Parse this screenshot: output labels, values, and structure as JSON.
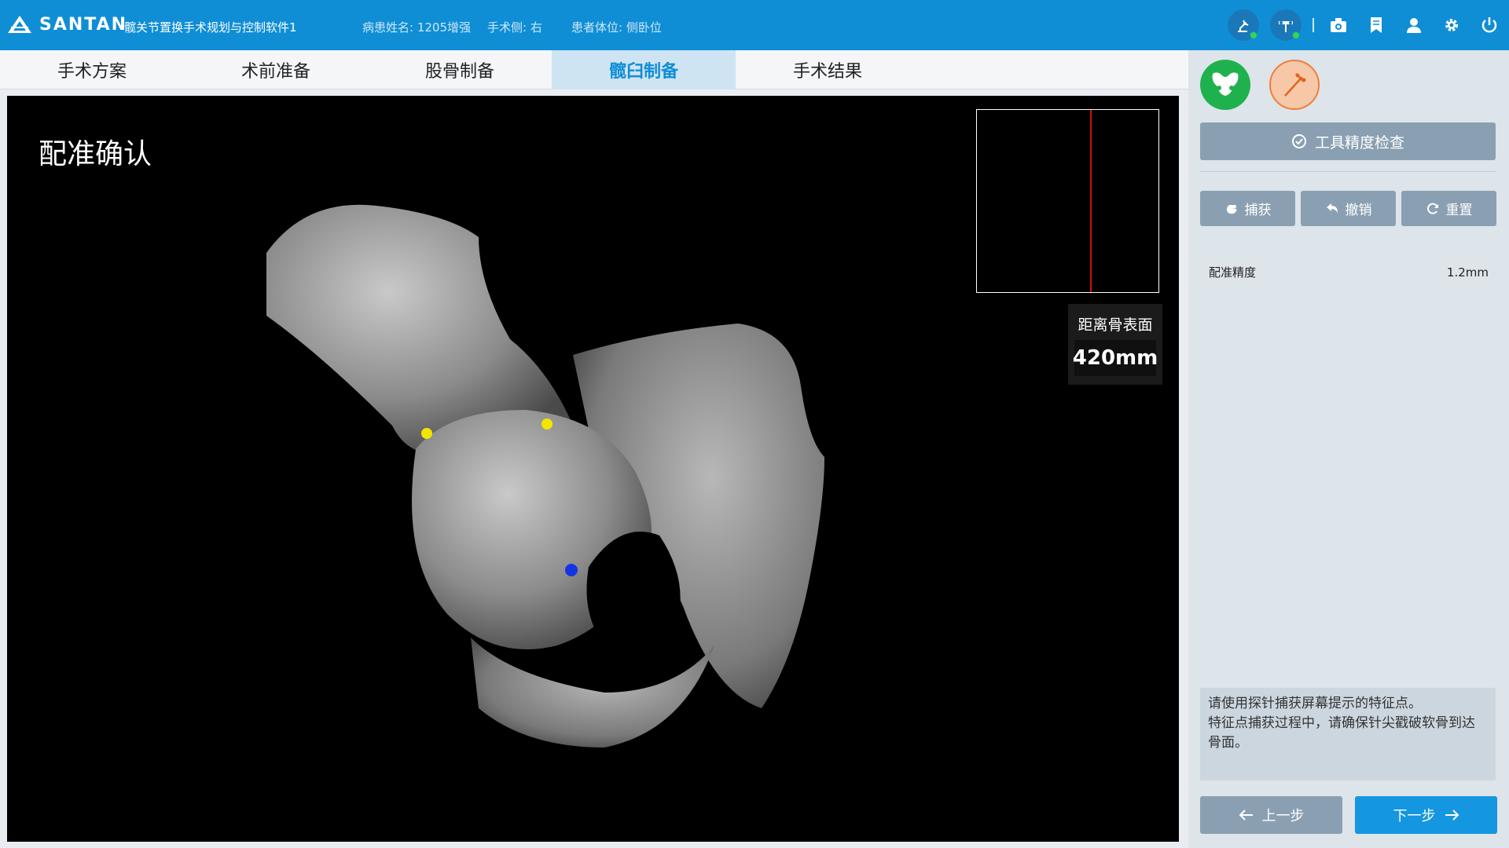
{
  "header": {
    "logo_text": "SANTAN",
    "app_title": "髋关节置换手术规划与控制软件1",
    "patient_name": "病患姓名: 1205增强",
    "surgery_side": "手术侧: 右",
    "patient_position": "患者体位: 侧卧位",
    "icons": [
      "robot-arm-icon",
      "probe-tracker-icon",
      "camera-icon",
      "bookmark-icon",
      "user-icon",
      "gear-icon",
      "power-icon"
    ],
    "status_color": "#3bd34a",
    "brand_color": "#0f8ed6"
  },
  "tabs": [
    {
      "label": "手术方案"
    },
    {
      "label": "术前准备"
    },
    {
      "label": "股骨制备"
    },
    {
      "label": "髋臼制备",
      "active": true
    },
    {
      "label": "手术结果"
    }
  ],
  "viewport": {
    "title": "配准确认",
    "distance_label": "距离骨表面",
    "distance_value": "420mm",
    "landmark_colors": [
      "#f2e600",
      "#f2e600",
      "#1533e6"
    ]
  },
  "panel": {
    "mode_icons": [
      "pelvis-icon",
      "probe-icon"
    ],
    "tool_check_label": "工具精度检查",
    "capture_label": "捕获",
    "undo_label": "撤销",
    "reset_label": "重置",
    "accuracy_label": "配准精度",
    "accuracy_value": "1.2mm",
    "instruction_line1": "请使用探针捕获屏幕提示的特征点。",
    "instruction_line2": "特征点捕获过程中，请确保针尖戳破软骨到达骨面。",
    "prev_label": "上一步",
    "next_label": "下一步"
  }
}
